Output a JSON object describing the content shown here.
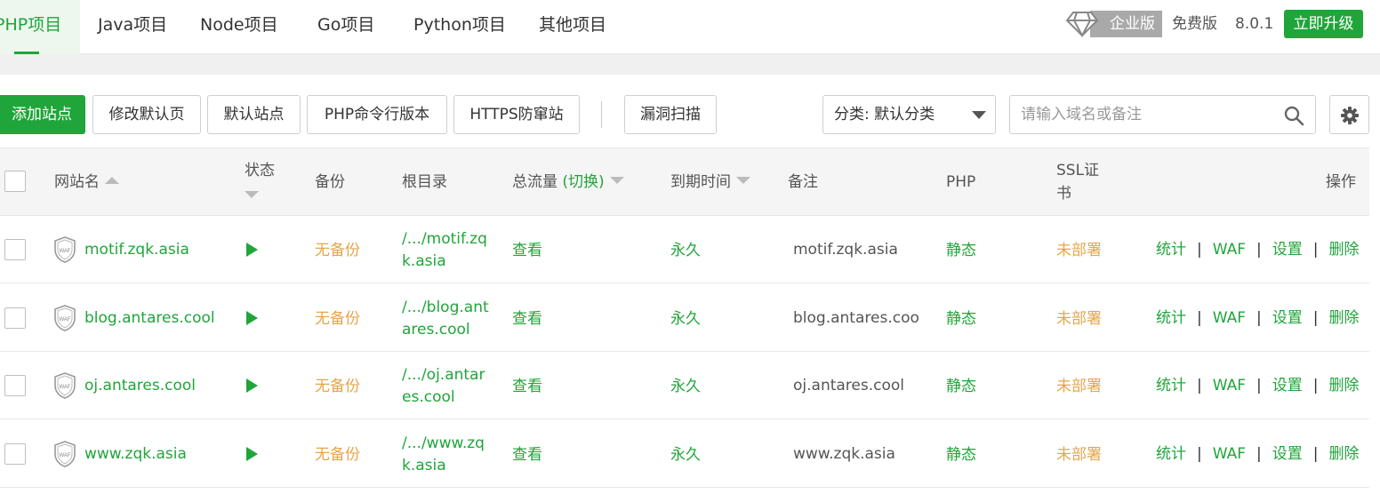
{
  "nav": {
    "tabs": [
      {
        "label": "PHP项目",
        "active": true
      },
      {
        "label": "Java项目",
        "active": false
      },
      {
        "label": "Node项目",
        "active": false
      },
      {
        "label": "Go项目",
        "active": false
      },
      {
        "label": "Python项目",
        "active": false
      },
      {
        "label": "其他项目",
        "active": false
      }
    ],
    "edition": "企业版",
    "free_label": "免费版",
    "version": "8.0.1",
    "upgrade_label": "立即升级"
  },
  "toolbar": {
    "add_site": "添加站点",
    "edit_default_page": "修改默认页",
    "default_site": "默认站点",
    "php_cli_version": "PHP命令行版本",
    "https_protect": "HTTPS防窜站",
    "vuln_scan": "漏洞扫描",
    "category_select": "分类: 默认分类",
    "search_placeholder": "请输入域名或备注"
  },
  "table": {
    "headers": {
      "site_name": "网站名",
      "status": "状态",
      "backup": "备份",
      "root_dir": "根目录",
      "traffic": "总流量",
      "traffic_switch": "(切换)",
      "expire": "到期时间",
      "remark": "备注",
      "php": "PHP",
      "ssl_line1": "SSL证",
      "ssl_line2": "书",
      "actions": "操作"
    },
    "rows": [
      {
        "name": "motif.zqk.asia",
        "backup": "无备份",
        "root_line1": "/.../motif.zq",
        "root_line2": "k.asia",
        "traffic": "查看",
        "expire": "永久",
        "remark": "motif.zqk.asia",
        "php": "静态",
        "ssl": "未部署"
      },
      {
        "name": "blog.antares.cool",
        "backup": "无备份",
        "root_line1": "/.../blog.ant",
        "root_line2": "ares.cool",
        "traffic": "查看",
        "expire": "永久",
        "remark": "blog.antares.coo",
        "php": "静态",
        "ssl": "未部署"
      },
      {
        "name": "oj.antares.cool",
        "backup": "无备份",
        "root_line1": "/.../oj.antar",
        "root_line2": "es.cool",
        "traffic": "查看",
        "expire": "永久",
        "remark": "oj.antares.cool",
        "php": "静态",
        "ssl": "未部署"
      },
      {
        "name": "www.zqk.asia",
        "backup": "无备份",
        "root_line1": "/.../www.zq",
        "root_line2": "k.asia",
        "traffic": "查看",
        "expire": "永久",
        "remark": "www.zqk.asia",
        "php": "静态",
        "ssl": "未部署"
      }
    ],
    "actions": {
      "stats": "统计",
      "waf": "WAF",
      "settings": "设置",
      "delete": "删除",
      "separator": "|"
    },
    "waf_badge": "WAF"
  }
}
